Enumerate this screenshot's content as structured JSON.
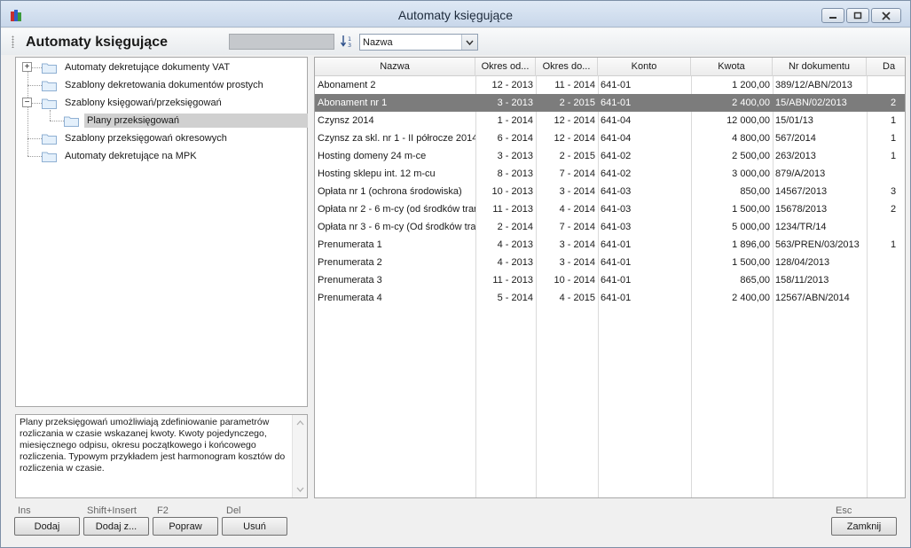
{
  "window": {
    "title": "Automaty księgujące"
  },
  "toolbar": {
    "title": "Automaty księgujące",
    "search_value": "",
    "sort_select": "Nazwa"
  },
  "tree": {
    "items": [
      {
        "label": "Automaty dekretujące dokumenty VAT",
        "expander": "+"
      },
      {
        "label": "Szablony dekretowania dokumentów prostych",
        "expander": ""
      },
      {
        "label": "Szablony księgowań/przeksięgowań",
        "expander": "−"
      },
      {
        "label": "Plany przeksięgowań",
        "expander": ""
      },
      {
        "label": "Szablony przeksięgowań okresowych",
        "expander": ""
      },
      {
        "label": "Automaty dekretujące na MPK",
        "expander": ""
      }
    ],
    "selected_index": 3
  },
  "description": "Plany przeksięgowań umożliwiają zdefiniowanie parametrów rozliczania w czasie wskazanej kwoty. Kwoty pojedynczego, miesięcznego odpisu, okresu początkowego i końcowego rozliczenia. Typowym przykładem jest harmonogram kosztów do rozliczenia w czasie.",
  "grid": {
    "columns": [
      "Nazwa",
      "Okres od...",
      "Okres do...",
      "Konto",
      "Kwota",
      "Nr dokumentu",
      "Da"
    ],
    "rows": [
      [
        "Abonament 2",
        "12 - 2013",
        "11 - 2014",
        "641-01",
        "1 200,00",
        "389/12/ABN/2013",
        ""
      ],
      [
        "Abonament nr 1",
        "3 - 2013",
        "2 - 2015",
        "641-01",
        "2 400,00",
        "15/ABN/02/2013",
        "2"
      ],
      [
        "Czynsz 2014",
        "1 - 2014",
        "12 - 2014",
        "641-04",
        "12 000,00",
        "15/01/13",
        "1"
      ],
      [
        "Czynsz za skl. nr 1 - II półrocze 2014",
        "6 - 2014",
        "12 - 2014",
        "641-04",
        "4 800,00",
        "567/2014",
        "1"
      ],
      [
        "Hosting domeny 24 m-ce",
        "3 - 2013",
        "2 - 2015",
        "641-02",
        "2 500,00",
        "263/2013",
        "1"
      ],
      [
        "Hosting sklepu int. 12 m-cu",
        "8 - 2013",
        "7 - 2014",
        "641-02",
        "3 000,00",
        "879/A/2013",
        ""
      ],
      [
        "Opłata nr 1 (ochrona środowiska)",
        "10 - 2013",
        "3 - 2014",
        "641-03",
        "850,00",
        "14567/2013",
        "3"
      ],
      [
        "Opłata nr 2 - 6 m-cy (od środków tran",
        "11 - 2013",
        "4 - 2014",
        "641-03",
        "1 500,00",
        "15678/2013",
        "2"
      ],
      [
        "Opłata nr 3 - 6 m-cy (Od środków tran",
        "2 - 2014",
        "7 - 2014",
        "641-03",
        "5 000,00",
        "1234/TR/14",
        ""
      ],
      [
        "Prenumerata 1",
        "4 - 2013",
        "3 - 2014",
        "641-01",
        "1 896,00",
        "563/PREN/03/2013",
        "1"
      ],
      [
        "Prenumerata 2",
        "4 - 2013",
        "3 - 2014",
        "641-01",
        "1 500,00",
        "128/04/2013",
        ""
      ],
      [
        "Prenumerata 3",
        "11 - 2013",
        "10 - 2014",
        "641-01",
        "865,00",
        "158/11/2013",
        ""
      ],
      [
        "Prenumerata 4",
        "5 - 2014",
        "4 - 2015",
        "641-01",
        "2 400,00",
        "12567/ABN/2014",
        ""
      ]
    ],
    "selected_index": 1
  },
  "buttons": {
    "dodaj": {
      "label": "Dodaj",
      "shortcut": "Ins"
    },
    "dodaj_z": {
      "label": "Dodaj z...",
      "shortcut": "Shift+Insert"
    },
    "popraw": {
      "label": "Popraw",
      "shortcut": "F2"
    },
    "usun": {
      "label": "Usuń",
      "shortcut": "Del"
    },
    "zamknij": {
      "label": "Zamknij",
      "shortcut": "Esc"
    }
  },
  "icons": [
    "app-icon",
    "minimize-icon",
    "maximize-icon",
    "close-icon",
    "grip-icon",
    "sort-icon",
    "chevron-down-icon",
    "folder-icon"
  ],
  "colors": {
    "selection": "#7c7c7c",
    "tree_selection": "#d0d0d0",
    "title_bar": "#c8d7ea"
  }
}
